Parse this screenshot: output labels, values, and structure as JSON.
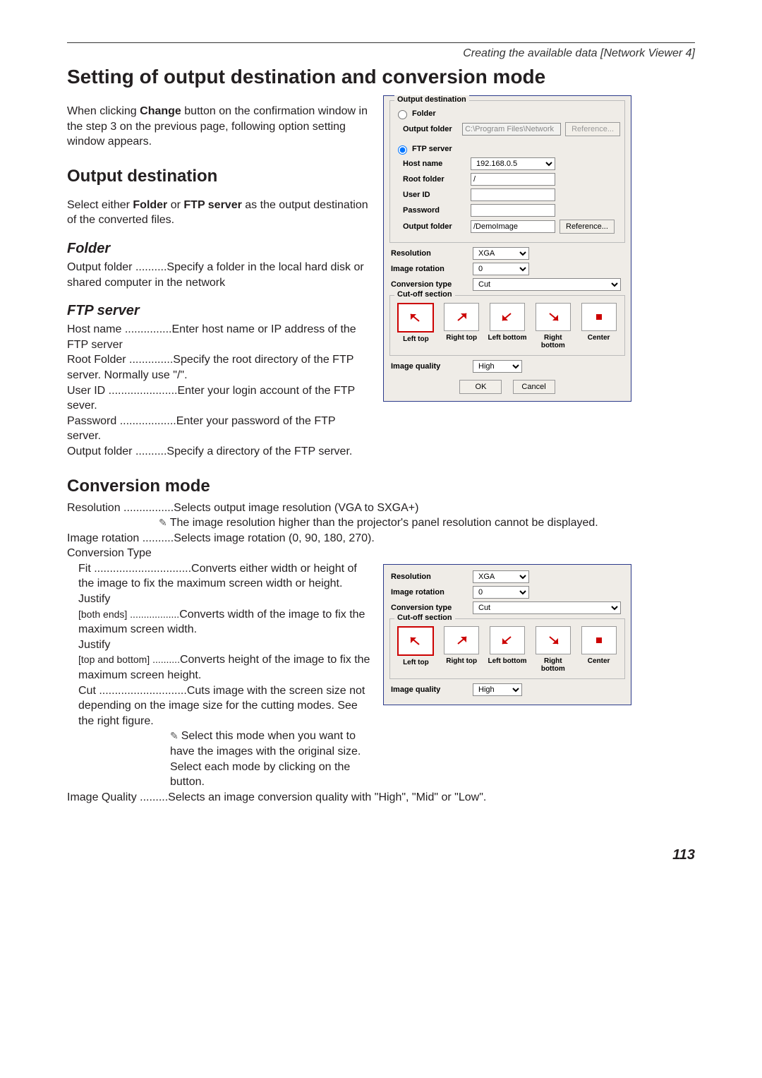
{
  "breadcrumb": "Creating the available data [Network Viewer 4]",
  "h1": "Setting of output destination and conversion mode",
  "intro_a": "When clicking ",
  "intro_b": "Change",
  "intro_c": " button on the confirmation window in the step 3 on the previous page, following option setting window appears.",
  "h2_output": "Output destination",
  "output_para_a": "Select either ",
  "output_para_b": "Folder",
  "output_para_c": " or ",
  "output_para_d": "FTP server",
  "output_para_e": " as the output destination of the converted files.",
  "h3_folder": "Folder",
  "folder_def_label": "Output folder ..........",
  "folder_def_desc": "Specify a folder in the local hard disk or shared computer in the network",
  "h3_ftp": "FTP server",
  "ftp_host_label": "Host name ...............",
  "ftp_host_desc": "Enter host name or IP address of the FTP server",
  "ftp_root_label": "Root Folder ..............",
  "ftp_root_desc": "Specify the root directory of the FTP server. Normally use \"/\".",
  "ftp_user_label": "User ID ......................",
  "ftp_user_desc": "Enter your login account of the FTP sever.",
  "ftp_pass_label": "Password ..................",
  "ftp_pass_desc": "Enter your password of the FTP server.",
  "ftp_out_label": "Output folder ..........",
  "ftp_out_desc": "Specify a directory of the FTP server.",
  "h2_conv": "Conversion mode",
  "conv_res_label": "Resolution ................",
  "conv_res_desc": "Selects output image resolution (VGA to SXGA+)",
  "conv_res_note": "The image resolution higher than the projector's panel resolution cannot be displayed.",
  "conv_rot_label": "Image rotation ..........",
  "conv_rot_desc": "Selects image rotation (0, 90, 180, 270).",
  "conv_type_label": "Conversion Type",
  "conv_fit_label": "Fit ...............................",
  "conv_fit_desc": "Converts either width or height of the image  to fix the maximum screen width or height.",
  "conv_j1": "Justify",
  "conv_j1b": "[both ends] ..................",
  "conv_j1_desc": "Converts width of the image to fix the maximum screen width.",
  "conv_j2": "Justify",
  "conv_j2b": "[top and bottom] ..........",
  "conv_j2_desc": "Converts height of the image to fix the maximum screen height.",
  "conv_cut_label": "Cut ............................",
  "conv_cut_desc": "Cuts image with the screen size not depending on the image size for the cutting modes. See the right figure.",
  "conv_cut_note": "Select this mode when you want to have the images with the original size. Select each mode by clicking on the button.",
  "conv_qual_label": "Image Quality .........",
  "conv_qual_desc": "Selects an image conversion quality with \"High\", \"Mid\" or \"Low\".",
  "page_num": "113",
  "dialog": {
    "grp_output": "Output destination",
    "radio_folder": "Folder",
    "lbl_output_folder": "Output folder",
    "val_folder_out": "C:\\Program Files\\Network",
    "btn_reference": "Reference...",
    "radio_ftp": "FTP server",
    "lbl_host": "Host name",
    "val_host": "192.168.0.5",
    "lbl_root": "Root folder",
    "val_root": "/",
    "lbl_user": "User ID",
    "val_user": "",
    "lbl_pass": "Password",
    "val_pass": "",
    "lbl_outf": "Output folder",
    "val_outf": "/DemoImage",
    "lbl_resolution": "Resolution",
    "val_resolution": "XGA",
    "lbl_rotation": "Image rotation",
    "val_rotation": "0",
    "lbl_convtype": "Conversion type",
    "val_convtype": "Cut",
    "grp_cutoff": "Cut-off section",
    "cut_labels": [
      "Left top",
      "Right top",
      "Left bottom",
      "Right bottom",
      "Center"
    ],
    "lbl_quality": "Image quality",
    "val_quality": "High",
    "btn_ok": "OK",
    "btn_cancel": "Cancel"
  }
}
